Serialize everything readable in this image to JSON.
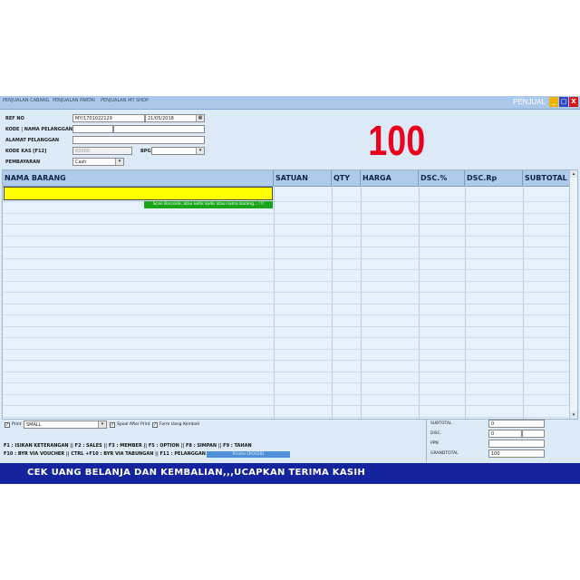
{
  "titlebar": {
    "tabs": [
      "PENJUALAN CABANG",
      "PENJUALAN PARTAI",
      "PENJUALAN MY SHOP"
    ],
    "window_title": "PENJUAL",
    "buttons": [
      "_",
      "□",
      "X"
    ],
    "colors": {
      "minimize": "#f0b400",
      "maximize": "#3048c8",
      "close": "#d01818"
    }
  },
  "form": {
    "ref_no_label": "REF NO",
    "ref_no_value": "MY/1701022129",
    "date_value": "21/05/2018",
    "kode_nama_label": "KODE | NAMA PELANGGAN",
    "alamat_label": "ALAMAT PELANGGAN",
    "kode_kas_label": "KODE KAS [F12]",
    "kode_kas_value": "K0000",
    "bpg_label": "BPG",
    "pembayaran_label": "PEMBAYARAN",
    "pembayaran_value": "Cash"
  },
  "big_total": "100",
  "grid": {
    "columns": [
      "NAMA BARANG",
      "SATUAN",
      "QTY",
      "HARGA",
      "DSC.%",
      "DSC.Rp",
      "SUBTOTAL"
    ],
    "hint": "Scan Barcode, atau ketik kode atau nama barang... !!!"
  },
  "bottom": {
    "print_label": "Print",
    "print_size": "SMALL",
    "spool_label": "Spool After Print",
    "form_uang_label": "Form Uang Kembali",
    "fkeys_line1": "F1 : ISIKAN KETERANGAN  || F2 : SALES  || F3 : MEMBER  || F5 : OPTION   || F8 : SIMPAN  || F9 : TAHAN",
    "fkeys_line2": "F10 : BYR VIA VOUCHER  || CTRL +F10 : BYR VIA TABUNGAN  || F11 : PELANGGAN",
    "printer_text": "Printer [POS58]"
  },
  "totals": {
    "subtotal_label": "SUBTOTAL",
    "subtotal_value": "0",
    "disc_label": "DISC.",
    "disc_value": "0",
    "ppn_label": "PPN",
    "grandtotal_label": "GRANDTOTAL",
    "grandtotal_value": "100"
  },
  "footer_text": "CEK UANG BELANJA DAN KEMBALIAN,,,UCAPKAN TERIMA KASIH"
}
